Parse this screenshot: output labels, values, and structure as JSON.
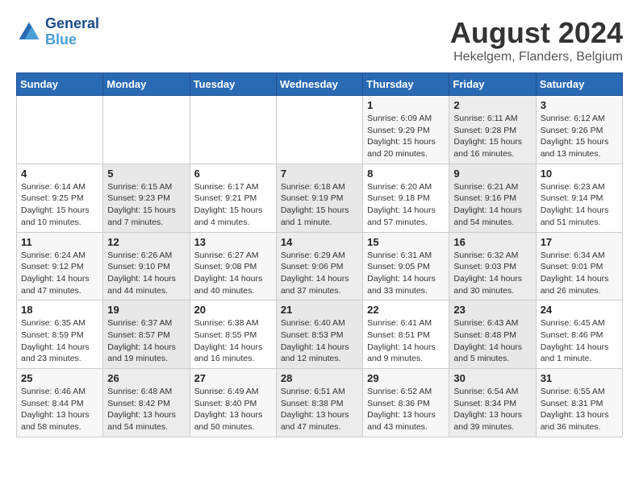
{
  "header": {
    "logo_line1": "General",
    "logo_line2": "Blue",
    "title": "August 2024",
    "subtitle": "Hekelgem, Flanders, Belgium"
  },
  "weekdays": [
    "Sunday",
    "Monday",
    "Tuesday",
    "Wednesday",
    "Thursday",
    "Friday",
    "Saturday"
  ],
  "weeks": [
    [
      {
        "day": "",
        "info": ""
      },
      {
        "day": "",
        "info": ""
      },
      {
        "day": "",
        "info": ""
      },
      {
        "day": "",
        "info": ""
      },
      {
        "day": "1",
        "info": "Sunrise: 6:09 AM\nSunset: 9:29 PM\nDaylight: 15 hours\nand 20 minutes."
      },
      {
        "day": "2",
        "info": "Sunrise: 6:11 AM\nSunset: 9:28 PM\nDaylight: 15 hours\nand 16 minutes."
      },
      {
        "day": "3",
        "info": "Sunrise: 6:12 AM\nSunset: 9:26 PM\nDaylight: 15 hours\nand 13 minutes."
      }
    ],
    [
      {
        "day": "4",
        "info": "Sunrise: 6:14 AM\nSunset: 9:25 PM\nDaylight: 15 hours\nand 10 minutes."
      },
      {
        "day": "5",
        "info": "Sunrise: 6:15 AM\nSunset: 9:23 PM\nDaylight: 15 hours\nand 7 minutes."
      },
      {
        "day": "6",
        "info": "Sunrise: 6:17 AM\nSunset: 9:21 PM\nDaylight: 15 hours\nand 4 minutes."
      },
      {
        "day": "7",
        "info": "Sunrise: 6:18 AM\nSunset: 9:19 PM\nDaylight: 15 hours\nand 1 minute."
      },
      {
        "day": "8",
        "info": "Sunrise: 6:20 AM\nSunset: 9:18 PM\nDaylight: 14 hours\nand 57 minutes."
      },
      {
        "day": "9",
        "info": "Sunrise: 6:21 AM\nSunset: 9:16 PM\nDaylight: 14 hours\nand 54 minutes."
      },
      {
        "day": "10",
        "info": "Sunrise: 6:23 AM\nSunset: 9:14 PM\nDaylight: 14 hours\nand 51 minutes."
      }
    ],
    [
      {
        "day": "11",
        "info": "Sunrise: 6:24 AM\nSunset: 9:12 PM\nDaylight: 14 hours\nand 47 minutes."
      },
      {
        "day": "12",
        "info": "Sunrise: 6:26 AM\nSunset: 9:10 PM\nDaylight: 14 hours\nand 44 minutes."
      },
      {
        "day": "13",
        "info": "Sunrise: 6:27 AM\nSunset: 9:08 PM\nDaylight: 14 hours\nand 40 minutes."
      },
      {
        "day": "14",
        "info": "Sunrise: 6:29 AM\nSunset: 9:06 PM\nDaylight: 14 hours\nand 37 minutes."
      },
      {
        "day": "15",
        "info": "Sunrise: 6:31 AM\nSunset: 9:05 PM\nDaylight: 14 hours\nand 33 minutes."
      },
      {
        "day": "16",
        "info": "Sunrise: 6:32 AM\nSunset: 9:03 PM\nDaylight: 14 hours\nand 30 minutes."
      },
      {
        "day": "17",
        "info": "Sunrise: 6:34 AM\nSunset: 9:01 PM\nDaylight: 14 hours\nand 26 minutes."
      }
    ],
    [
      {
        "day": "18",
        "info": "Sunrise: 6:35 AM\nSunset: 8:59 PM\nDaylight: 14 hours\nand 23 minutes."
      },
      {
        "day": "19",
        "info": "Sunrise: 6:37 AM\nSunset: 8:57 PM\nDaylight: 14 hours\nand 19 minutes."
      },
      {
        "day": "20",
        "info": "Sunrise: 6:38 AM\nSunset: 8:55 PM\nDaylight: 14 hours\nand 16 minutes."
      },
      {
        "day": "21",
        "info": "Sunrise: 6:40 AM\nSunset: 8:53 PM\nDaylight: 14 hours\nand 12 minutes."
      },
      {
        "day": "22",
        "info": "Sunrise: 6:41 AM\nSunset: 8:51 PM\nDaylight: 14 hours\nand 9 minutes."
      },
      {
        "day": "23",
        "info": "Sunrise: 6:43 AM\nSunset: 8:48 PM\nDaylight: 14 hours\nand 5 minutes."
      },
      {
        "day": "24",
        "info": "Sunrise: 6:45 AM\nSunset: 8:46 PM\nDaylight: 14 hours\nand 1 minute."
      }
    ],
    [
      {
        "day": "25",
        "info": "Sunrise: 6:46 AM\nSunset: 8:44 PM\nDaylight: 13 hours\nand 58 minutes."
      },
      {
        "day": "26",
        "info": "Sunrise: 6:48 AM\nSunset: 8:42 PM\nDaylight: 13 hours\nand 54 minutes."
      },
      {
        "day": "27",
        "info": "Sunrise: 6:49 AM\nSunset: 8:40 PM\nDaylight: 13 hours\nand 50 minutes."
      },
      {
        "day": "28",
        "info": "Sunrise: 6:51 AM\nSunset: 8:38 PM\nDaylight: 13 hours\nand 47 minutes."
      },
      {
        "day": "29",
        "info": "Sunrise: 6:52 AM\nSunset: 8:36 PM\nDaylight: 13 hours\nand 43 minutes."
      },
      {
        "day": "30",
        "info": "Sunrise: 6:54 AM\nSunset: 8:34 PM\nDaylight: 13 hours\nand 39 minutes."
      },
      {
        "day": "31",
        "info": "Sunrise: 6:55 AM\nSunset: 8:31 PM\nDaylight: 13 hours\nand 36 minutes."
      }
    ]
  ]
}
